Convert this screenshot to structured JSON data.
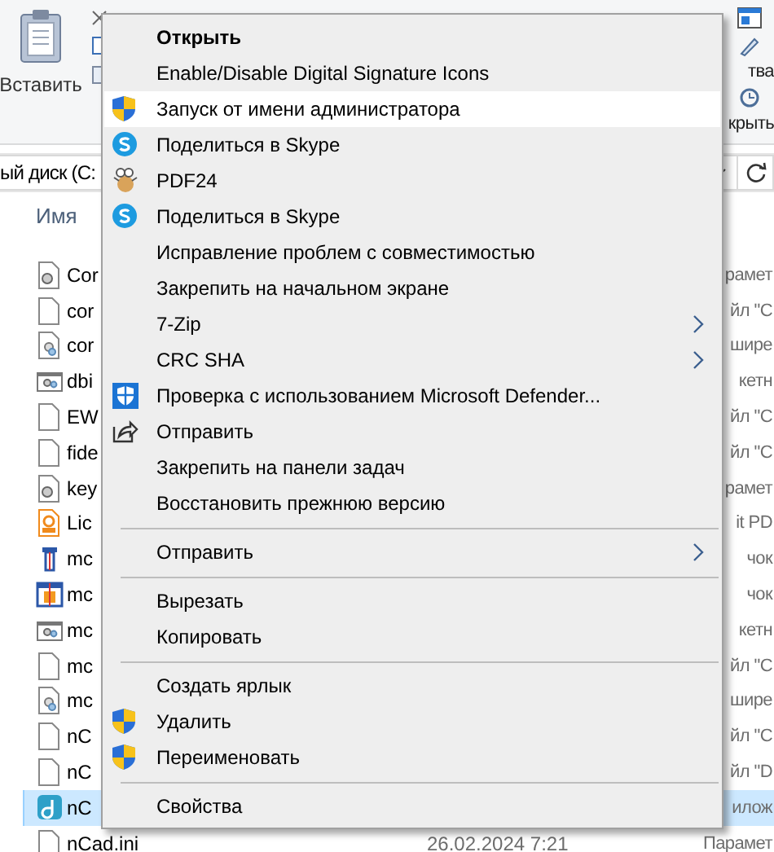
{
  "ribbon": {
    "paste_label": "Вставить",
    "right_labels": [
      "тва",
      "крыть"
    ]
  },
  "address": {
    "path": "ый диск (C:"
  },
  "column_header": "Имя",
  "files": [
    {
      "name": "Cor",
      "type": "рамет",
      "kind": "gear",
      "selected": false
    },
    {
      "name": "cor",
      "type": "йл \"C",
      "kind": "plain",
      "selected": false
    },
    {
      "name": "cor",
      "type": "шире",
      "kind": "gear-doc",
      "selected": false
    },
    {
      "name": "dbi",
      "type": "кетн",
      "kind": "window",
      "selected": false
    },
    {
      "name": "EW",
      "type": "йл \"C",
      "kind": "plain",
      "selected": false
    },
    {
      "name": "fide",
      "type": "йл \"C",
      "kind": "plain",
      "selected": false
    },
    {
      "name": "key",
      "type": "рамет",
      "kind": "gear",
      "selected": false
    },
    {
      "name": "Lic",
      "type": "it PD",
      "kind": "pdf",
      "selected": false
    },
    {
      "name": "mc",
      "type": "чок",
      "kind": "tool",
      "selected": false
    },
    {
      "name": "mc",
      "type": "чок",
      "kind": "tool-box",
      "selected": false
    },
    {
      "name": "mc",
      "type": "кетн",
      "kind": "window",
      "selected": false
    },
    {
      "name": "mc",
      "type": "йл \"C",
      "kind": "plain",
      "selected": false
    },
    {
      "name": "mc",
      "type": "шире",
      "kind": "gear-doc",
      "selected": false
    },
    {
      "name": "nC",
      "type": "йл \"C",
      "kind": "plain",
      "selected": false
    },
    {
      "name": "nC",
      "type": "йл \"D",
      "kind": "plain",
      "selected": false
    },
    {
      "name": "nC",
      "type": "илож",
      "kind": "app",
      "selected": true
    },
    {
      "name": "nCad.ini",
      "date": "26.02.2024 7:21",
      "type": "Парамет",
      "kind": "plain",
      "selected": false
    }
  ],
  "context_menu": [
    {
      "kind": "item",
      "label": "Открыть",
      "bold": true,
      "selected": false
    },
    {
      "kind": "item",
      "label": "Enable/Disable Digital Signature Icons",
      "selected": false
    },
    {
      "kind": "shield",
      "label": "Запуск от имени администратора",
      "selected": true
    },
    {
      "kind": "skype",
      "label": "Поделиться в Skype",
      "selected": false
    },
    {
      "kind": "pdf24",
      "label": "PDF24",
      "selected": false
    },
    {
      "kind": "skype",
      "label": "Поделиться в Skype",
      "selected": false
    },
    {
      "kind": "item",
      "label": "Исправление проблем с совместимостью",
      "selected": false
    },
    {
      "kind": "item",
      "label": "Закрепить на начальном экране",
      "selected": false
    },
    {
      "kind": "item",
      "label": "7-Zip",
      "submenu": true,
      "selected": false
    },
    {
      "kind": "item",
      "label": "CRC SHA",
      "submenu": true,
      "selected": false
    },
    {
      "kind": "defender",
      "label": "Проверка с использованием Microsoft Defender...",
      "selected": false
    },
    {
      "kind": "share",
      "label": "Отправить",
      "selected": false
    },
    {
      "kind": "item",
      "label": "Закрепить на панели задач",
      "selected": false
    },
    {
      "kind": "item",
      "label": "Восстановить прежнюю версию",
      "selected": false
    },
    {
      "kind": "separator"
    },
    {
      "kind": "item",
      "label": "Отправить",
      "submenu": true,
      "selected": false
    },
    {
      "kind": "separator"
    },
    {
      "kind": "item",
      "label": "Вырезать",
      "selected": false
    },
    {
      "kind": "item",
      "label": "Копировать",
      "selected": false
    },
    {
      "kind": "separator"
    },
    {
      "kind": "item",
      "label": "Создать ярлык",
      "selected": false
    },
    {
      "kind": "shield",
      "label": "Удалить",
      "selected": false
    },
    {
      "kind": "shield",
      "label": "Переименовать",
      "selected": false
    },
    {
      "kind": "separator"
    },
    {
      "kind": "item",
      "label": "Свойства",
      "selected": false
    }
  ]
}
